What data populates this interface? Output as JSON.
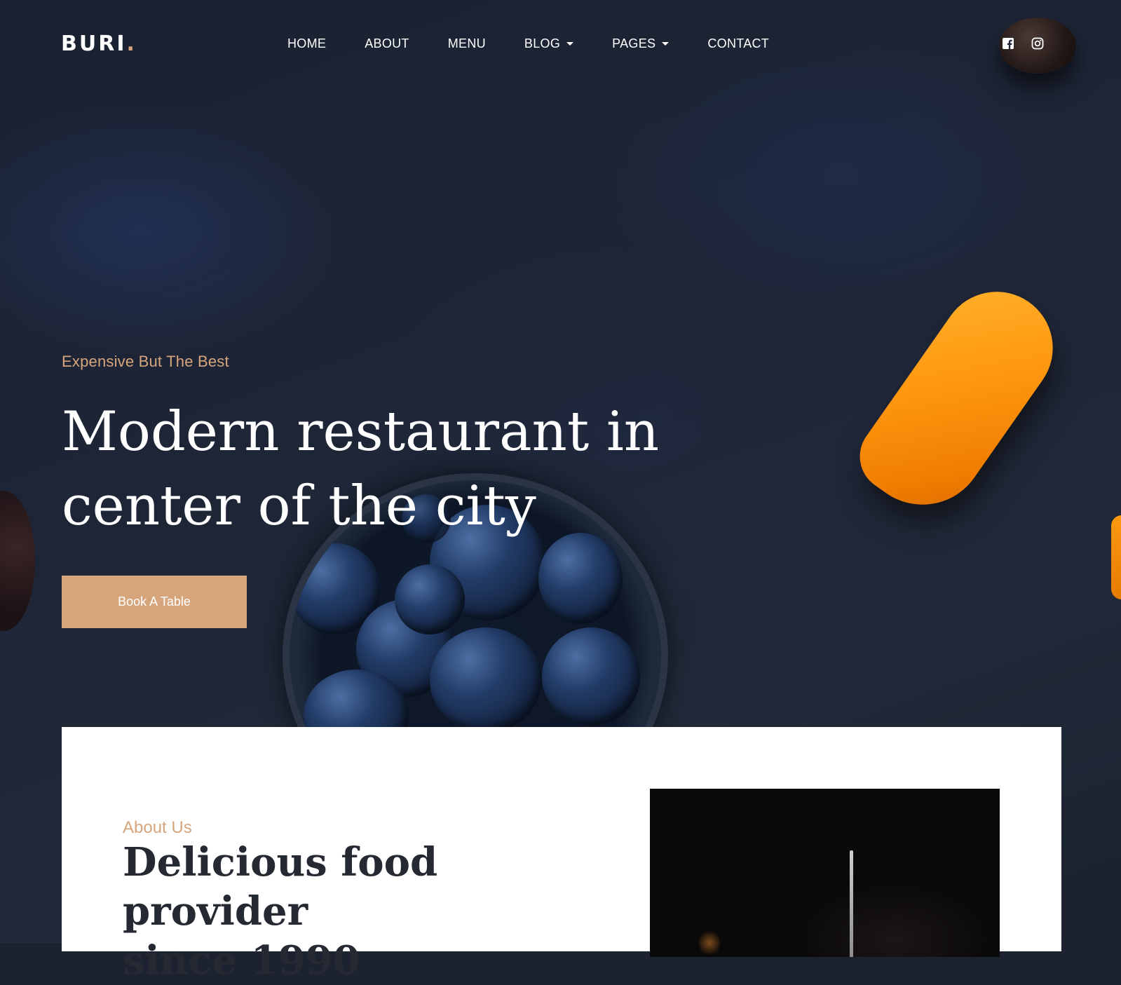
{
  "brand": {
    "name": "BURI",
    "dot": "."
  },
  "nav": [
    {
      "label": "HOME",
      "has_dropdown": false
    },
    {
      "label": "ABOUT",
      "has_dropdown": false
    },
    {
      "label": "MENU",
      "has_dropdown": false
    },
    {
      "label": "BLOG",
      "has_dropdown": true
    },
    {
      "label": "PAGES",
      "has_dropdown": true
    },
    {
      "label": "CONTACT",
      "has_dropdown": false
    }
  ],
  "social": [
    {
      "icon": "facebook-icon"
    },
    {
      "icon": "instagram-icon"
    }
  ],
  "hero": {
    "eyebrow": "Expensive But The Best",
    "headline_line1": "Modern restaurant in",
    "headline_line2": "center of the city",
    "cta_label": "Book A Table"
  },
  "about": {
    "eyebrow": "About Us",
    "title_line1": "Delicious food provider",
    "title_line2": "since 1990"
  },
  "colors": {
    "accent": "#d6a57c",
    "background": "#1e2536",
    "text_dark": "#252932"
  }
}
